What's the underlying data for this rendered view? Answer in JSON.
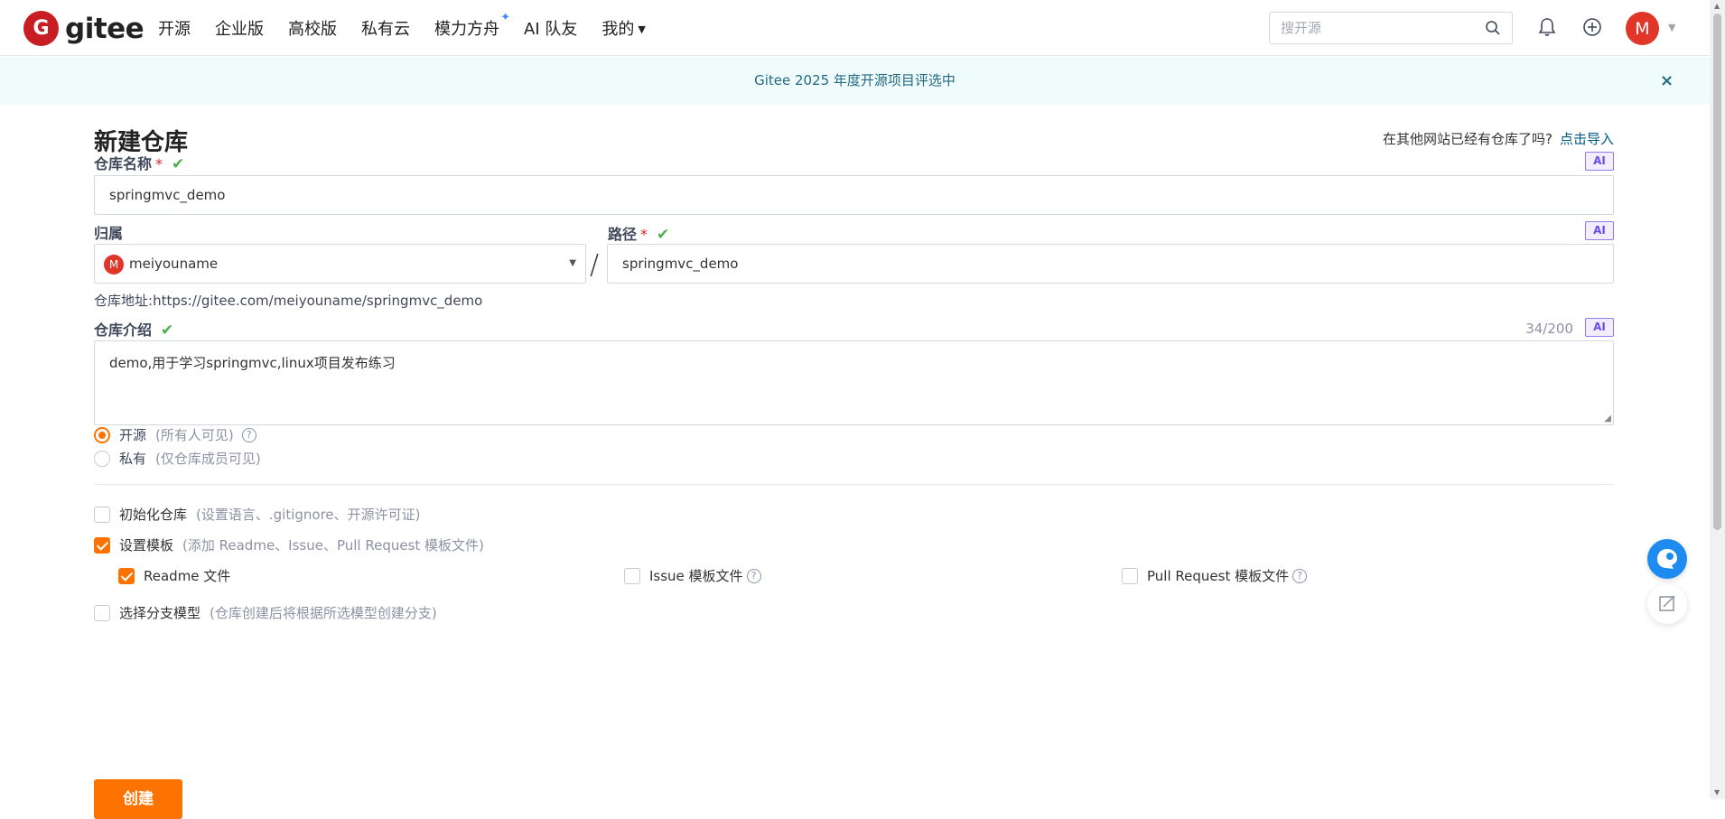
{
  "header": {
    "logo_mark": "G",
    "logo_text": "gitee",
    "nav": [
      "开源",
      "企业版",
      "高校版",
      "私有云",
      "模力方舟",
      "AI 队友",
      "我的"
    ],
    "search_placeholder": "搜开源",
    "avatar_letter": "M"
  },
  "banner": {
    "text": "Gitee 2025 年度开源项目评选中",
    "close": "×"
  },
  "page": {
    "title": "新建仓库",
    "import_prompt": "在其他网站已经有仓库了吗?",
    "import_link": "点击导入",
    "ai_badge": "AI"
  },
  "form": {
    "repo_name_label": "仓库名称",
    "repo_name_value": "springmvc_demo",
    "owner_label": "归属",
    "owner_avatar": "M",
    "owner_value": "meiyouname",
    "slash": "/",
    "path_label": "路径",
    "path_value": "springmvc_demo",
    "address_prefix": "仓库地址:",
    "address_url": "https://gitee.com/meiyouname/springmvc_demo",
    "desc_label": "仓库介绍",
    "desc_counter": "34/200",
    "desc_value": "demo,用于学习springmvc,linux项目发布练习",
    "required_mark": "*",
    "valid_mark": "✔",
    "visibility": [
      {
        "label": "开源",
        "hint": "(所有人可见)",
        "selected": true,
        "help": "?"
      },
      {
        "label": "私有",
        "hint": "(仅仓库成员可见)",
        "selected": false
      }
    ],
    "init_repo": {
      "label": "初始化仓库",
      "hint": "(设置语言、.gitignore、开源许可证)",
      "checked": false
    },
    "template": {
      "label": "设置模板",
      "hint": "(添加 Readme、Issue、Pull Request 模板文件)",
      "checked": true
    },
    "template_options": [
      {
        "label": "Readme 文件",
        "checked": true
      },
      {
        "label": "Issue 模板文件",
        "checked": false,
        "help": "?"
      },
      {
        "label": "Pull Request 模板文件",
        "checked": false,
        "help": "?"
      }
    ],
    "branch_model": {
      "label": "选择分支模型",
      "hint": "(仓库创建后将根据所选模型创建分支)",
      "checked": false
    },
    "create_button": "创建"
  },
  "colors": {
    "brand": "#c71d23",
    "accent": "#fe7300",
    "link": "#005980",
    "valid": "#4caf50"
  }
}
